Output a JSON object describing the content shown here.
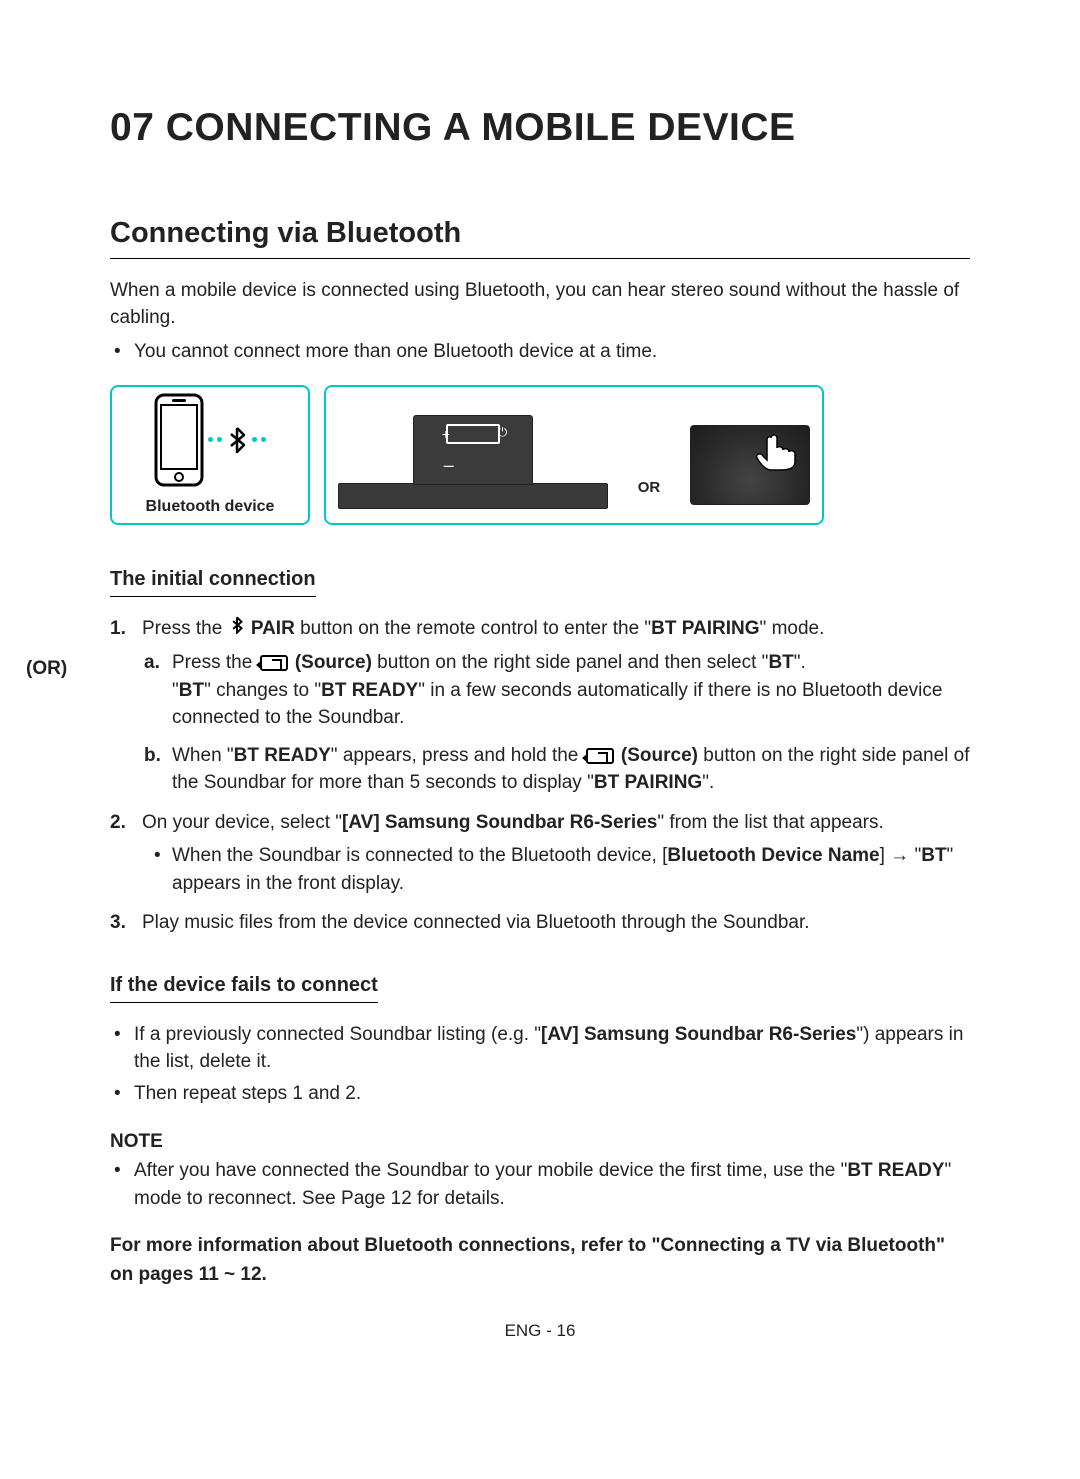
{
  "title": "07  CONNECTING A MOBILE DEVICE",
  "section": "Connecting via Bluetooth",
  "intro": "When a mobile device is connected using Bluetooth, you can hear stereo sound without the hassle of cabling.",
  "intro_bullet": "You cannot connect more than one Bluetooth device at a time.",
  "bt_device_label": "Bluetooth device",
  "or_label": "OR",
  "sub1": "The initial connection",
  "step1_num": "1.",
  "step1_pre": "Press the ",
  "step1_pair": " PAIR",
  "step1_mid": " button on the remote control to enter the \"",
  "step1_btpairing": "BT PAIRING",
  "step1_suf": "\" mode.",
  "or_paren": "(OR)",
  "step_a_letter": "a.",
  "step_a_pre": "Press the ",
  "step_a_source": " (Source)",
  "step_a_mid": " button on the right side panel and then select \"",
  "step_a_bt": "BT",
  "step_a_suf": "\".",
  "step_a_line2_pre": "\"",
  "step_a_line2_bt": "BT",
  "step_a_line2_mid": "\" changes to \"",
  "step_a_line2_btr": "BT READY",
  "step_a_line2_suf": "\" in a few seconds automatically if there is no Bluetooth device connected to the Soundbar.",
  "step_b_letter": "b.",
  "step_b_pre": "When \"",
  "step_b_btr": "BT READY",
  "step_b_mid": "\" appears, press and hold the ",
  "step_b_source": " (Source)",
  "step_b_mid2": " button on the right side panel of the Soundbar for more than 5 seconds to display \"",
  "step_b_btp": "BT PAIRING",
  "step_b_suf": "\".",
  "step2_num": "2.",
  "step2_pre": "On your device, select \"",
  "step2_av": "[AV] Samsung Soundbar R6-Series",
  "step2_suf": "\" from the list that appears.",
  "step2_bullet_pre": "When the Soundbar is connected to the Bluetooth device, [",
  "step2_bullet_bdn": "Bluetooth Device Name",
  "step2_bullet_mid": "] → \"",
  "step2_bullet_bt": "BT",
  "step2_bullet_suf": "\" appears in the front display.",
  "step3_num": "3.",
  "step3": "Play music files from the device connected via Bluetooth through the Soundbar.",
  "sub2": "If the device fails to connect",
  "fail_b1_pre": "If a previously connected Soundbar listing (e.g. \"",
  "fail_b1_av": "[AV] Samsung Soundbar R6-Series",
  "fail_b1_suf": "\") appears in the list, delete it.",
  "fail_b2": "Then repeat steps 1 and 2.",
  "note_label": "NOTE",
  "note_pre": "After you have connected the Soundbar to your mobile device the first time, use the \"",
  "note_btr": "BT READY",
  "note_suf": "\" mode to reconnect. See Page 12 for details.",
  "final": "For more information about Bluetooth connections, refer to \"Connecting a TV via Bluetooth\" on pages 11 ~ 12.",
  "footer": "ENG - 16"
}
